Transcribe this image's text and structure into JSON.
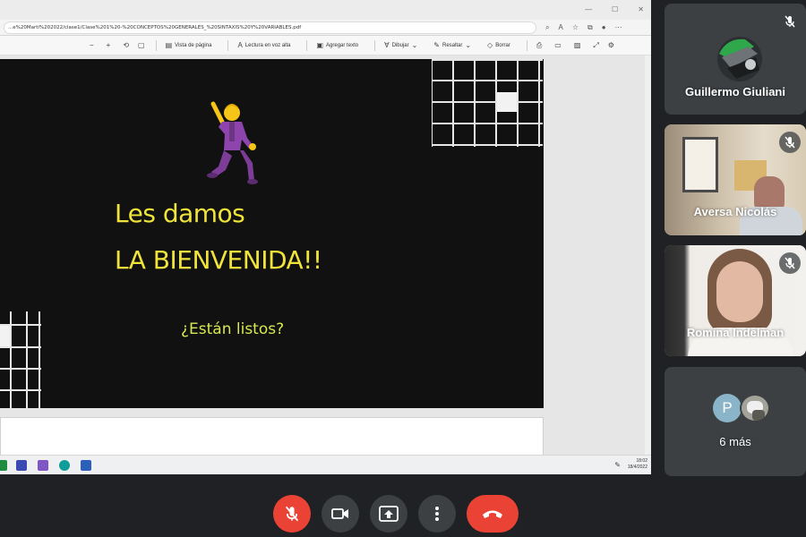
{
  "browser": {
    "url": "...e%20Marti%202022/clase1/Clase%201%20-%20CONCEPTOS%20GENERALES_%20SINTAXIS%20Y%20VARIABLES.pdf"
  },
  "pdf_toolbar": {
    "page_view": "Vista de página",
    "read_aloud": "Lectura en voz alta",
    "add_text": "Agregar texto",
    "draw": "Dibujar",
    "highlight": "Resaltar",
    "erase": "Borrar"
  },
  "slide": {
    "line1": "Les damos",
    "line2": "LA BIENVENIDA!!",
    "question": "¿Están listos?",
    "text_color": "#f0e43a",
    "background": "#111111"
  },
  "taskbar": {
    "clock_time": "18:02",
    "clock_date": "18/4/2022"
  },
  "participants": [
    {
      "name": "Guillermo Giuliani",
      "muted": true
    },
    {
      "name": "Aversa Nicolás",
      "muted": true
    },
    {
      "name": "Romina Indelman",
      "muted": true
    }
  ],
  "more_tile": {
    "avatar_initial": "P",
    "label": "6 más"
  },
  "colors": {
    "call_bg": "#202124",
    "control_bg": "#3c4043",
    "danger": "#ea4335"
  }
}
